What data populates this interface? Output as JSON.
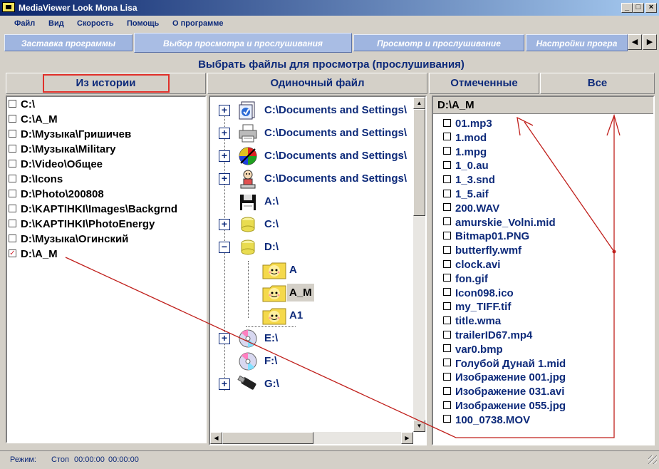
{
  "window": {
    "title": "MediaViewer Look Mona Lisa",
    "controls": {
      "minimize": "_",
      "maximize": "□",
      "close": "×"
    }
  },
  "menu": [
    "Файл",
    "Вид",
    "Скорость",
    "Помощь",
    "О программе"
  ],
  "tabs": [
    {
      "label": "Заставка программы",
      "active": false
    },
    {
      "label": "Выбор просмотра и прослушивания",
      "active": true
    },
    {
      "label": "Просмотр и прослушивание",
      "active": false
    },
    {
      "label": "Настройки програ",
      "active": false
    }
  ],
  "tab_scroll": {
    "left": "◀",
    "right": "▶"
  },
  "heading": "Выбрать файлы для просмотра (прослушивания)",
  "section_buttons": {
    "history": "Из истории",
    "single_file": "Одиночный файл",
    "marked": "Отмеченные",
    "all": "Все"
  },
  "history": [
    {
      "path": "C:\\",
      "checked": false
    },
    {
      "path": "C:\\A_M",
      "checked": false
    },
    {
      "path": "D:\\Музыка\\Гришичев",
      "checked": false
    },
    {
      "path": "D:\\Музыка\\Military",
      "checked": false
    },
    {
      "path": "D:\\Video\\Общее",
      "checked": false
    },
    {
      "path": "D:\\Icons",
      "checked": false
    },
    {
      "path": "D:\\Photo\\200808",
      "checked": false
    },
    {
      "path": "D:\\KAPTIHKI\\Images\\Backgrnd",
      "checked": false
    },
    {
      "path": "D:\\KAPTIHKI\\PhotoEnergy",
      "checked": false
    },
    {
      "path": "D:\\Музыка\\Огинский",
      "checked": false
    },
    {
      "path": "D:\\A_M",
      "checked": true
    }
  ],
  "tree": [
    {
      "label": "C:\\Documents and Settings\\",
      "expander": "+",
      "icon": "documents-icon"
    },
    {
      "label": "C:\\Documents and Settings\\",
      "expander": "+",
      "icon": "printer-icon"
    },
    {
      "label": "C:\\Documents and Settings\\",
      "expander": "+",
      "icon": "palette-icon"
    },
    {
      "label": "C:\\Documents and Settings\\",
      "expander": "+",
      "icon": "user-figure-icon"
    },
    {
      "label": "A:\\",
      "expander": "",
      "icon": "floppy-drive-icon"
    },
    {
      "label": "C:\\",
      "expander": "+",
      "icon": "hard-drive-icon"
    },
    {
      "label": "D:\\",
      "expander": "−",
      "icon": "hard-drive-icon"
    },
    {
      "label": "A",
      "expander": "",
      "icon": "folder-face-icon"
    },
    {
      "label": "A_M",
      "expander": "",
      "icon": "folder-face-icon",
      "selected": true
    },
    {
      "label": "A1",
      "expander": "",
      "icon": "folder-face-icon"
    },
    {
      "label": "E:\\",
      "expander": "+",
      "icon": "cd-drive-icon"
    },
    {
      "label": "F:\\",
      "expander": "",
      "icon": "cd-drive-icon"
    },
    {
      "label": "G:\\",
      "expander": "+",
      "icon": "usb-drive-icon"
    }
  ],
  "right_header": "D:\\A_M",
  "files": [
    "01.mp3",
    "1.mod",
    "1.mpg",
    "1_0.au",
    "1_3.snd",
    "1_5.aif",
    "200.WAV",
    "amurskie_Volni.mid",
    "Bitmap01.PNG",
    "butterfly.wmf",
    "clock.avi",
    "fon.gif",
    "Icon098.ico",
    "my_TIFF.tif",
    "title.wma",
    "trailerID67.mp4",
    "var0.bmp",
    "Голубой Дунай 1.mid",
    "Изображение 001.jpg",
    "Изображение 031.avi",
    "Изображение 055.jpg",
    "100_0738.MOV"
  ],
  "status": {
    "mode_label": "Режим:",
    "state": "Стоп",
    "time1": "00:00:00",
    "time2": "00:00:00"
  },
  "colors": {
    "title_start": "#0a246a",
    "title_end": "#a6caf0",
    "text_blue": "#0d2a7a",
    "annotation_red": "#c0201c",
    "tab_bg": "#9fb5e0"
  }
}
